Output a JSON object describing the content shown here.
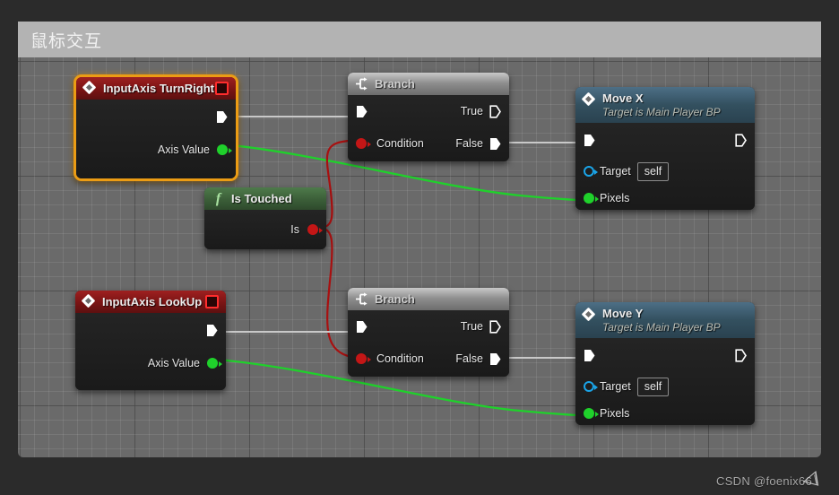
{
  "window": {
    "title": "鼠标交互"
  },
  "watermark": {
    "text": "CSDN @foenix66",
    "logo_icon": "csdn-logo-icon"
  },
  "colors": {
    "canvas": "#6a6a6a",
    "titlebar": "#b3b3b3",
    "backdrop": "#2b2b2b",
    "selection": "#eb9c14",
    "event_header": "#7a1414",
    "flow_header": "#8d8d8d",
    "function_header": "#3b5e38",
    "call_header": "#33505f",
    "exec_wire": "#c8c8c8",
    "bool_wire": "#a81010",
    "float_wire": "#1fd12b",
    "exec_pin": "#ffffff",
    "bool_pin": "#c41616",
    "float_pin": "#1fd12b",
    "object_pin": "#1aa4e8"
  },
  "nodes": [
    {
      "id": "input_axis_turn_right",
      "title": "InputAxis TurnRight",
      "subtitle": "",
      "kind": "event",
      "selected": true,
      "icon": "event-diamond-icon",
      "has_red_square": true,
      "outputs": [
        {
          "label": "",
          "pin": "exec"
        },
        {
          "label": "Axis Value",
          "pin": "float"
        }
      ]
    },
    {
      "id": "branch_top",
      "title": "Branch",
      "subtitle": "",
      "kind": "flow",
      "selected": false,
      "icon": "branch-icon",
      "has_red_square": false,
      "inputs": [
        {
          "label": "",
          "pin": "exec"
        },
        {
          "label": "Condition",
          "pin": "bool"
        }
      ],
      "outputs": [
        {
          "label": "True",
          "pin": "exec-hollow"
        },
        {
          "label": "False",
          "pin": "exec"
        }
      ]
    },
    {
      "id": "move_x",
      "title": "Move X",
      "subtitle": "Target is Main Player BP",
      "kind": "call",
      "selected": false,
      "icon": "function-diamond-icon",
      "has_red_square": false,
      "inputs": [
        {
          "label": "",
          "pin": "exec"
        },
        {
          "label": "Target",
          "pin": "object",
          "value": "self"
        },
        {
          "label": "Pixels",
          "pin": "float"
        }
      ],
      "outputs": [
        {
          "label": "",
          "pin": "exec-hollow"
        }
      ]
    },
    {
      "id": "is_touched",
      "title": "Is Touched",
      "subtitle": "",
      "kind": "function",
      "selected": false,
      "icon": "function-f-icon",
      "has_red_square": false,
      "outputs": [
        {
          "label": "Is",
          "pin": "bool"
        }
      ]
    },
    {
      "id": "input_axis_lookup",
      "title": "InputAxis LookUp",
      "subtitle": "",
      "kind": "event",
      "selected": false,
      "icon": "event-diamond-icon",
      "has_red_square": true,
      "outputs": [
        {
          "label": "",
          "pin": "exec"
        },
        {
          "label": "Axis Value",
          "pin": "float"
        }
      ]
    },
    {
      "id": "branch_bottom",
      "title": "Branch",
      "subtitle": "",
      "kind": "flow",
      "selected": false,
      "icon": "branch-icon",
      "has_red_square": false,
      "inputs": [
        {
          "label": "",
          "pin": "exec"
        },
        {
          "label": "Condition",
          "pin": "bool"
        }
      ],
      "outputs": [
        {
          "label": "True",
          "pin": "exec-hollow"
        },
        {
          "label": "False",
          "pin": "exec"
        }
      ]
    },
    {
      "id": "move_y",
      "title": "Move Y",
      "subtitle": "Target is Main Player BP",
      "kind": "call",
      "selected": false,
      "icon": "function-diamond-icon",
      "has_red_square": false,
      "inputs": [
        {
          "label": "",
          "pin": "exec"
        },
        {
          "label": "Target",
          "pin": "object",
          "value": "self"
        },
        {
          "label": "Pixels",
          "pin": "float"
        }
      ],
      "outputs": [
        {
          "label": "",
          "pin": "exec-hollow"
        }
      ]
    }
  ],
  "labels": {
    "axis_value": "Axis Value",
    "condition": "Condition",
    "true": "True",
    "false": "False",
    "target": "Target",
    "pixels": "Pixels",
    "is": "Is",
    "self": "self"
  }
}
